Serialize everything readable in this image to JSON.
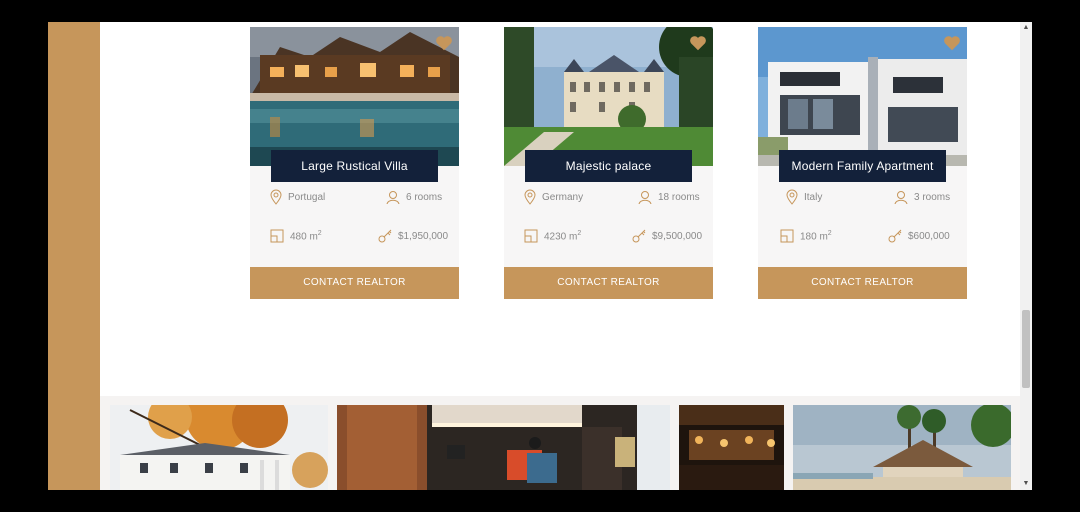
{
  "listings": [
    {
      "title": "Large Rustical Villa",
      "location": "Portugal",
      "rooms": "6 rooms",
      "area_value": "480 m",
      "area_sup": "2",
      "price": "$1,950,000",
      "contact_label": "CONTACT REALTOR",
      "image": "villa-pool-night-photo",
      "favorite_icon": "heart-icon"
    },
    {
      "title": "Majestic palace",
      "location": "Germany",
      "rooms": "18 rooms",
      "area_value": "4230 m",
      "area_sup": "2",
      "price": "$9,500,000",
      "contact_label": "CONTACT REALTOR",
      "image": "palace-garden-photo",
      "favorite_icon": "heart-icon"
    },
    {
      "title": "Modern Family Apartment",
      "location": "Italy",
      "rooms": "3 rooms",
      "area_value": "180 m",
      "area_sup": "2",
      "price": "$600,000",
      "contact_label": "CONTACT REALTOR",
      "image": "modern-house-photo",
      "favorite_icon": "heart-icon"
    }
  ],
  "gallery": [
    "autumn-mansion-photo",
    "interior-living-room-photo",
    "bar-interior-photo",
    "beach-resort-photo"
  ],
  "icons": [
    "location-pin-icon",
    "person-icon",
    "area-icon",
    "key-icon",
    "heart-icon",
    "scroll-up-arrow-icon",
    "scroll-down-arrow-icon"
  ],
  "colors": {
    "accent": "#c6965b",
    "title_bg": "#13213a",
    "card_bg": "#f7f6f6",
    "meta_text": "#8a8a8a"
  }
}
